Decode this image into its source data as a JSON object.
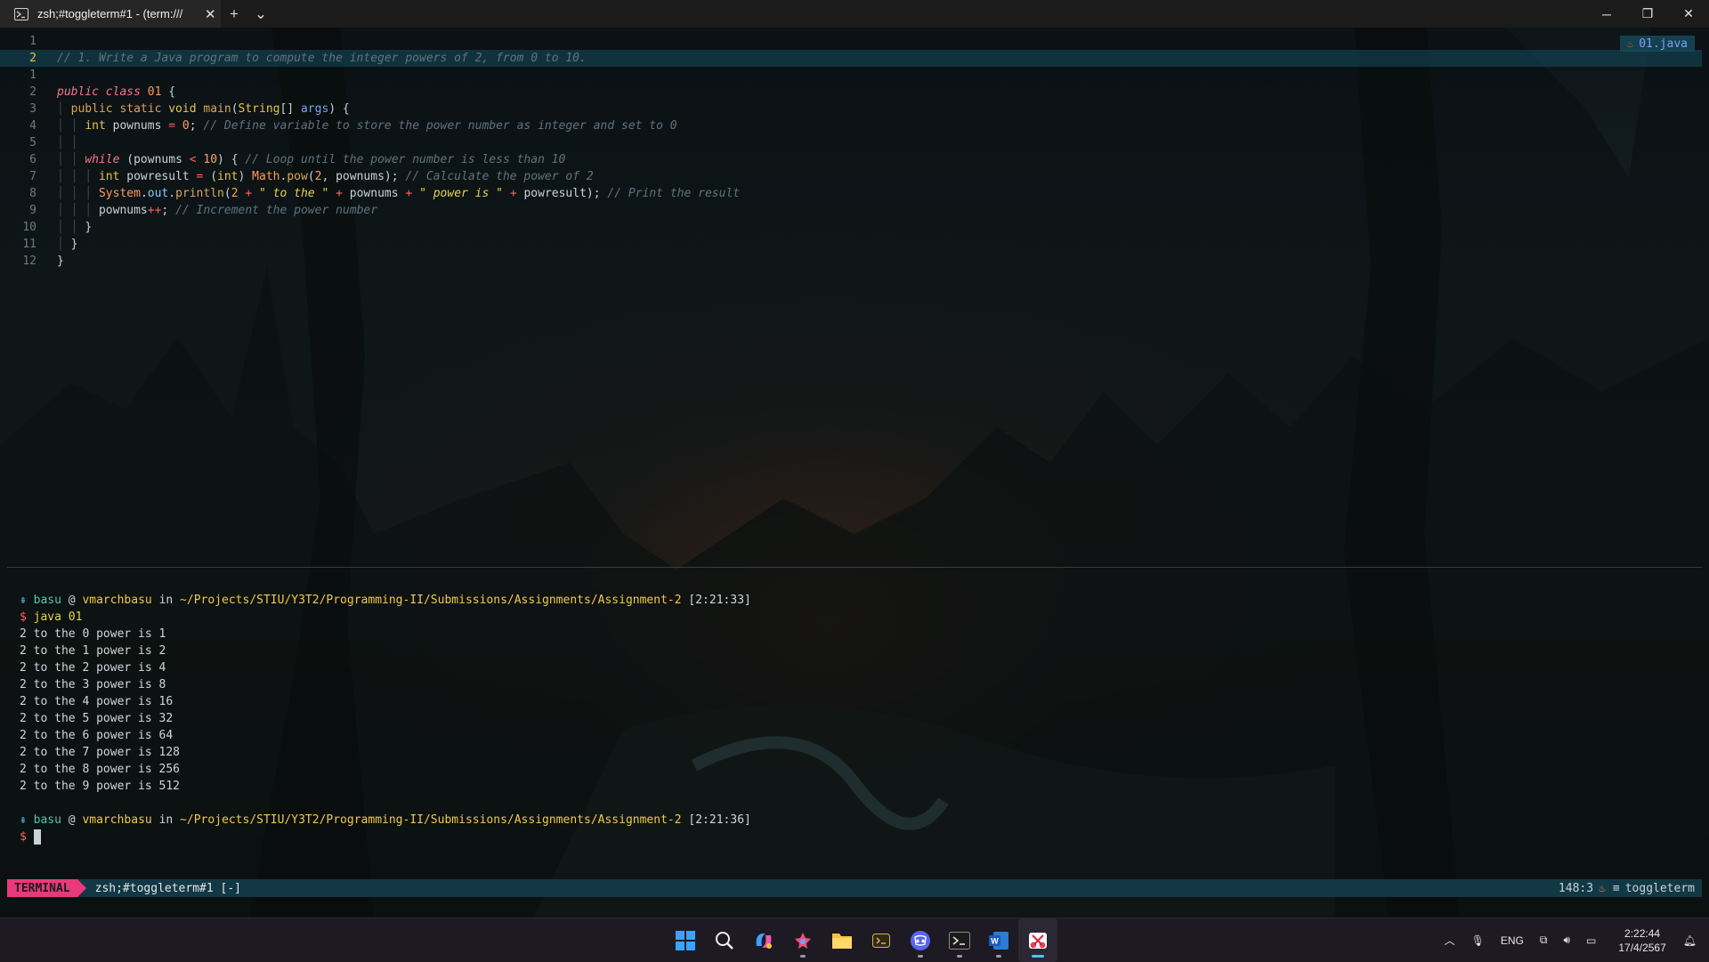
{
  "window": {
    "tab_title": "zsh;#toggleterm#1 - (term:///",
    "tab_close": "✕",
    "new_tab": "+",
    "tab_dropdown": "⌄",
    "minimize": "─",
    "maximize": "❐",
    "close": "✕"
  },
  "editor": {
    "file_badge": "01.java",
    "lines": [
      {
        "n": "1",
        "text": ""
      },
      {
        "n": "2",
        "text": "// 1. Write a Java program to compute the integer powers of 2, from 0 to 10."
      },
      {
        "n": "1",
        "text": ""
      },
      {
        "n": "2",
        "text": "public class 01 {"
      },
      {
        "n": "3",
        "text": "public static void main(String[] args) {"
      },
      {
        "n": "4",
        "text": "int pownums = 0; // Define variable to store the power number as integer and set to 0"
      },
      {
        "n": "5",
        "text": ""
      },
      {
        "n": "6",
        "text": "while (pownums < 10) { // Loop until the power number is less than 10"
      },
      {
        "n": "7",
        "text": "int powresult = (int) Math.pow(2, pownums); // Calculate the power of 2"
      },
      {
        "n": "8",
        "text": "System.out.println(2 + \" to the \" + pownums + \" power is \" + powresult); // Print the result"
      },
      {
        "n": "9",
        "text": "pownums++; // Increment the power number"
      },
      {
        "n": "10",
        "text": "}"
      },
      {
        "n": "11",
        "text": "}"
      },
      {
        "n": "12",
        "text": "}"
      }
    ]
  },
  "terminal": {
    "prompt1": {
      "git": "⇞",
      "user": "basu",
      "at": "@",
      "host": "vmarchbasu",
      "in": "in",
      "path": "~/Projects/STIU/Y3T2/Programming-II/Submissions/Assignments/Assignment-2",
      "time": "[2:21:33]"
    },
    "cmd_dollar": "$",
    "command": "java 01",
    "output": [
      "2 to the 0 power is 1",
      "2 to the 1 power is 2",
      "2 to the 2 power is 4",
      "2 to the 3 power is 8",
      "2 to the 4 power is 16",
      "2 to the 5 power is 32",
      "2 to the 6 power is 64",
      "2 to the 7 power is 128",
      "2 to the 8 power is 256",
      "2 to the 9 power is 512"
    ],
    "prompt2": {
      "git": "⇞",
      "user": "basu",
      "at": "@",
      "host": "vmarchbasu",
      "in": "in",
      "path": "~/Projects/STIU/Y3T2/Programming-II/Submissions/Assignments/Assignment-2",
      "time": "[2:21:36]"
    }
  },
  "statusline": {
    "mode": "TERMINAL",
    "name": "zsh;#toggleterm#1 [-]",
    "position": "148:3",
    "filetype": "toggleterm"
  },
  "taskbar": {
    "apps": [
      "windows-start",
      "search",
      "copilot",
      "app-store",
      "file-explorer",
      "terminal-app",
      "discord",
      "terminal",
      "word",
      "snipping-tool"
    ],
    "tray_language": "ENG",
    "time": "2:22:44",
    "date": "17/4/2567"
  }
}
